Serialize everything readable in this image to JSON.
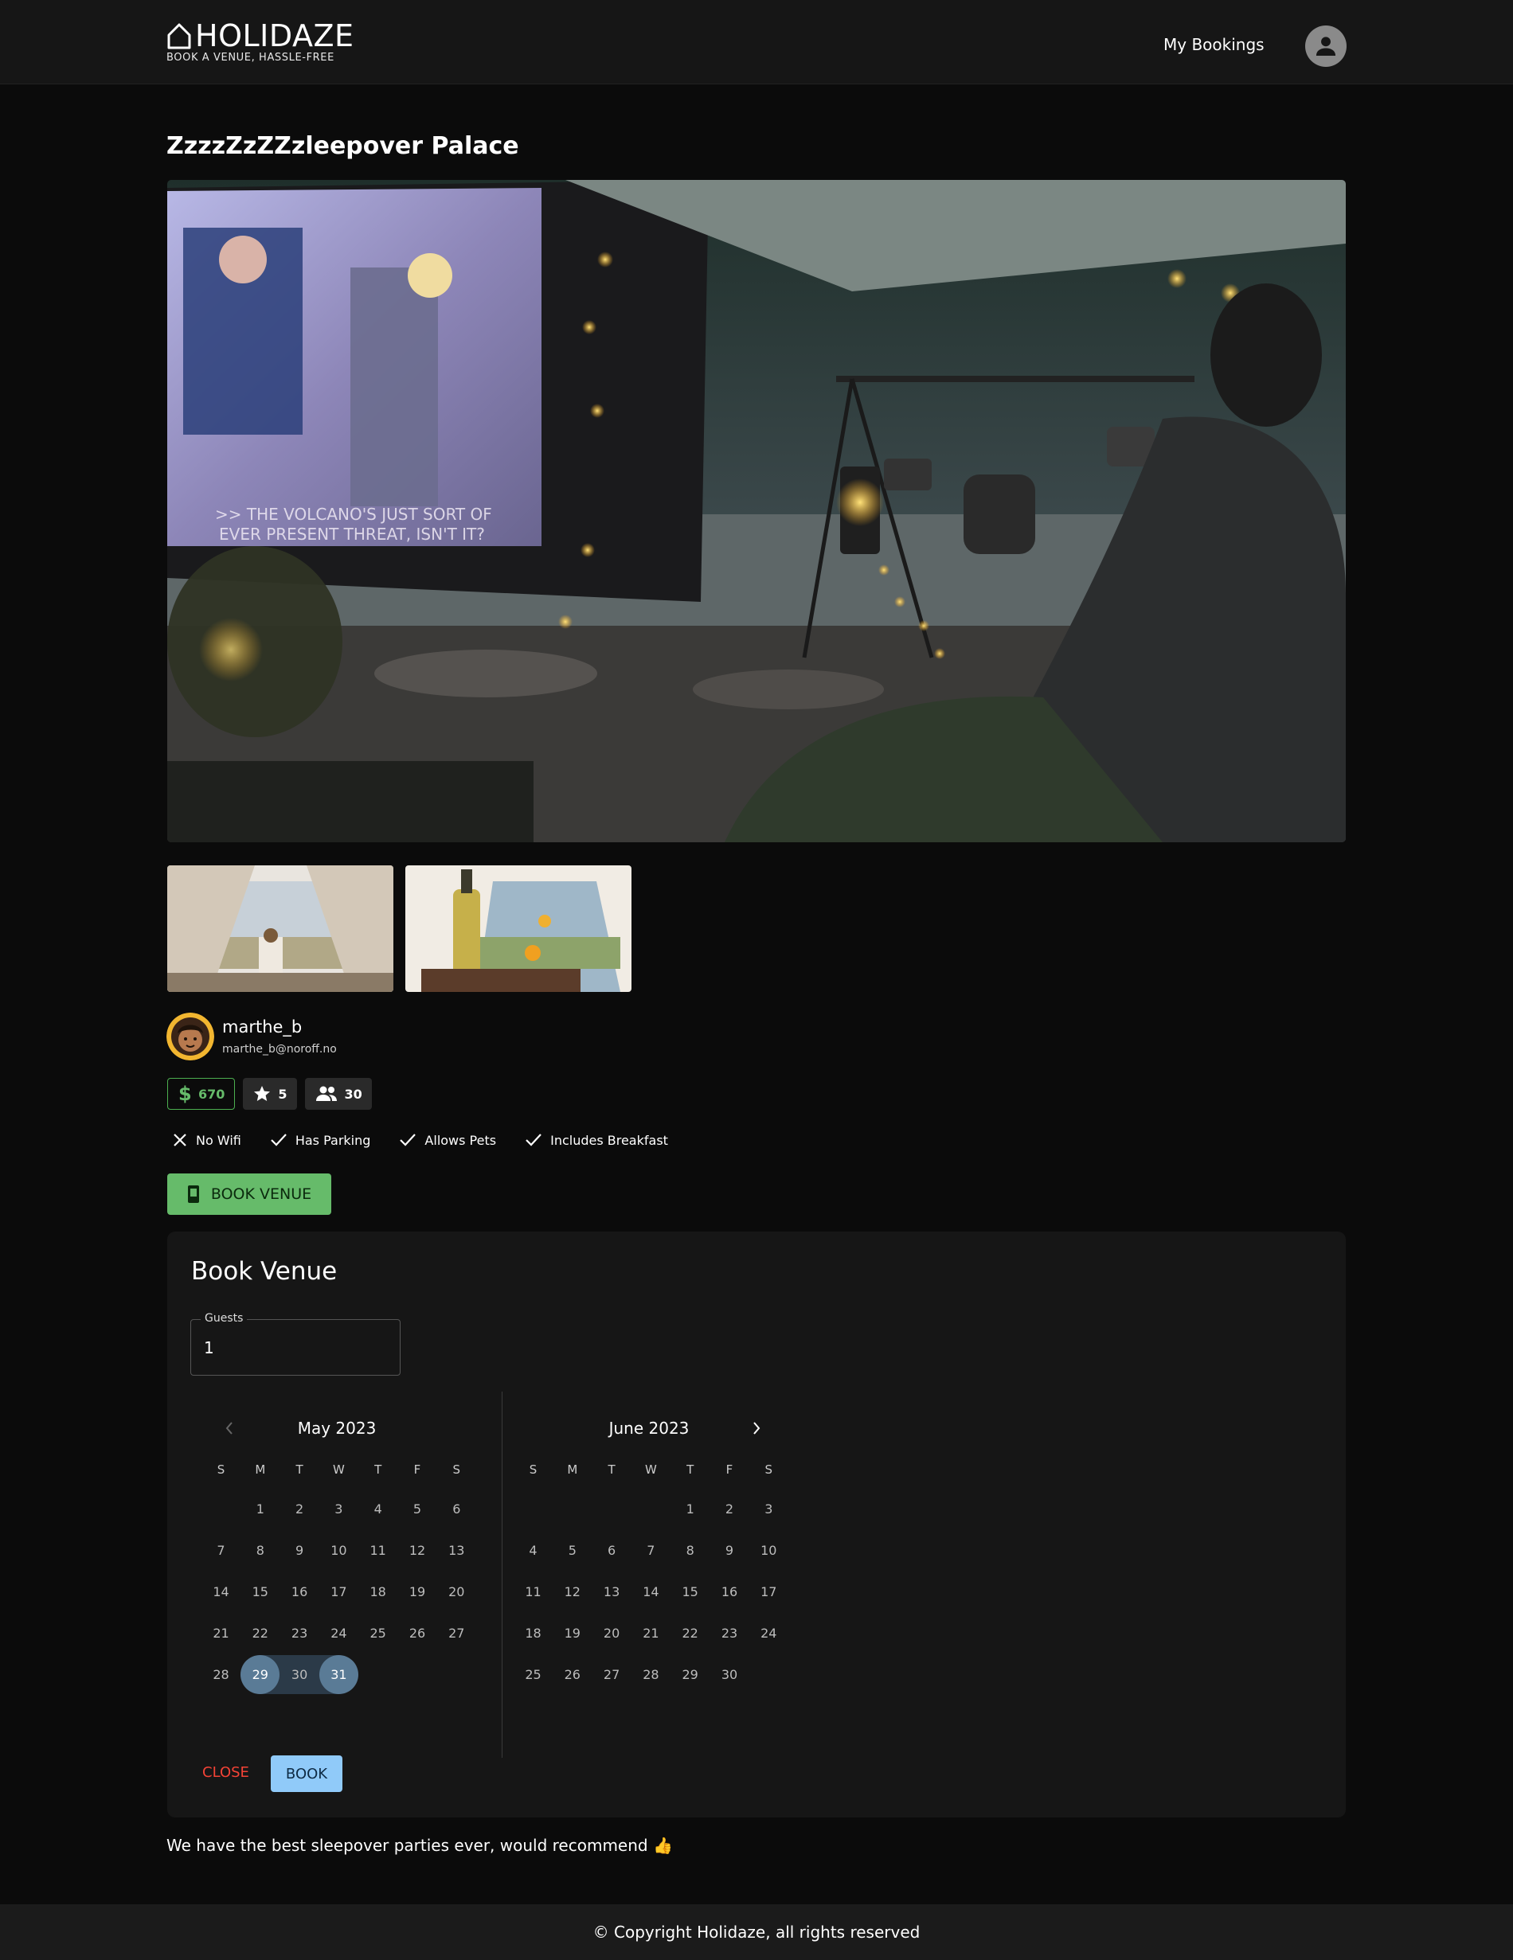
{
  "header": {
    "brand": "HOLIDAZE",
    "tagline": "BOOK A VENUE, HASSLE-FREE",
    "nav_bookings": "My Bookings",
    "account_icon": "person-icon"
  },
  "venue": {
    "name": "ZzzzZzZZzleepover Palace",
    "owner": {
      "name": "marthe_b",
      "email": "marthe_b@noroff.no"
    },
    "price": "670",
    "rating": "5",
    "max_guests": "30",
    "amenities": [
      {
        "label": "No Wifi",
        "icon": "close-icon",
        "available": false
      },
      {
        "label": "Has Parking",
        "icon": "check-icon",
        "available": true
      },
      {
        "label": "Allows Pets",
        "icon": "check-icon",
        "available": true
      },
      {
        "label": "Includes Breakfast",
        "icon": "check-icon",
        "available": true
      }
    ],
    "description": "We have the best sleepover parties ever, would recommend 👍"
  },
  "actions": {
    "book_venue": "BOOK VENUE"
  },
  "booking": {
    "title": "Book Venue",
    "guests_label": "Guests",
    "guests_value": "1",
    "weekdays": [
      "S",
      "M",
      "T",
      "W",
      "T",
      "F",
      "S"
    ],
    "months": [
      {
        "label": "May 2023",
        "first_weekday": 1,
        "days": 31,
        "selected": [
          29,
          31
        ],
        "in_range": [
          30
        ]
      },
      {
        "label": "June 2023",
        "first_weekday": 4,
        "days": 30,
        "selected": [],
        "in_range": []
      }
    ],
    "close_label": "CLOSE",
    "book_label": "BOOK"
  },
  "footer": {
    "copyright": "© Copyright Holidaze, all rights reserved"
  },
  "colors": {
    "accent_green": "#66bb6a",
    "accent_blue": "#90caf9",
    "danger": "#f44336",
    "selected_day": "#5a7b96"
  }
}
